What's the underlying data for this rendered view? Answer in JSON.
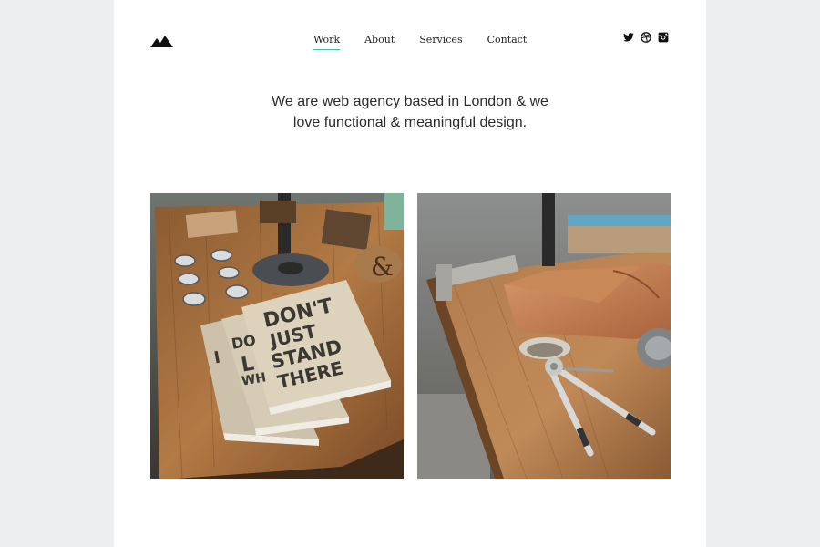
{
  "nav": {
    "items": [
      {
        "label": "Work",
        "active": true
      },
      {
        "label": "About"
      },
      {
        "label": "Services"
      },
      {
        "label": "Contact"
      }
    ]
  },
  "social": {
    "icons": [
      "twitter-icon",
      "dribbble-icon",
      "instagram-icon"
    ]
  },
  "hero": {
    "line1": "We are web agency based in London & we",
    "line2": "love functional & meaningful design."
  },
  "portfolio": {
    "items": [
      {
        "notebook_text": [
          "DON'T",
          "JUST",
          "STAND",
          "THERE"
        ]
      },
      {}
    ]
  },
  "colors": {
    "accent": "#44c4a1",
    "background": "#eceef0",
    "page": "#ffffff"
  }
}
